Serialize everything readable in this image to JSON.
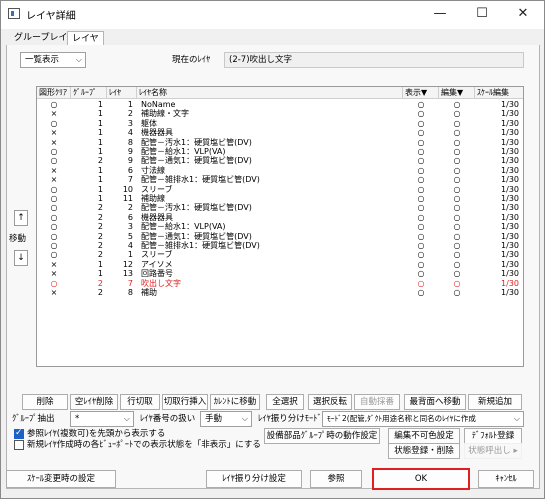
{
  "window": {
    "title": "レイヤ詳細",
    "controls": {
      "minimize": "—",
      "maximize": "☐",
      "close": "✕"
    }
  },
  "tabs": [
    {
      "label": "グループレイヤ"
    },
    {
      "label": "レイヤ"
    }
  ],
  "top": {
    "view_select": "一覧表示",
    "current_layer_label": "現在のﾚｲﾔ",
    "current_layer_value": "(2-7)吹出し文字"
  },
  "table": {
    "headers": {
      "shape": "図形ｸﾘｱ",
      "group": "ｸﾞﾙｰﾌﾟ",
      "layer": "ﾚｲﾔ",
      "name": "ﾚｲﾔ名称",
      "display": "表示▼",
      "edit": "編集▼",
      "scale": "ｽｹｰﾙ編集"
    },
    "rows": [
      {
        "shape": "○",
        "group": "1",
        "layer": "1",
        "name": "NoName",
        "display": "○",
        "edit": "○",
        "scale": "1/30",
        "red": false
      },
      {
        "shape": "×",
        "group": "1",
        "layer": "2",
        "name": "補助線・文字",
        "display": "○",
        "edit": "○",
        "scale": "1/30",
        "red": false
      },
      {
        "shape": "○",
        "group": "1",
        "layer": "3",
        "name": "躯体",
        "display": "○",
        "edit": "○",
        "scale": "1/30",
        "red": false
      },
      {
        "shape": "×",
        "group": "1",
        "layer": "4",
        "name": "機器器具",
        "display": "○",
        "edit": "○",
        "scale": "1/30",
        "red": false
      },
      {
        "shape": "×",
        "group": "1",
        "layer": "8",
        "name": "配管－汚水1：硬質塩ビ管(DV)",
        "display": "○",
        "edit": "○",
        "scale": "1/30",
        "red": false
      },
      {
        "shape": "○",
        "group": "1",
        "layer": "9",
        "name": "配管－給水1：VLP(VA)",
        "display": "○",
        "edit": "○",
        "scale": "1/30",
        "red": false
      },
      {
        "shape": "○",
        "group": "2",
        "layer": "9",
        "name": "配管－通気1：硬質塩ビ管(DV)",
        "display": "○",
        "edit": "○",
        "scale": "1/30",
        "red": false
      },
      {
        "shape": "×",
        "group": "1",
        "layer": "6",
        "name": "寸法線",
        "display": "○",
        "edit": "○",
        "scale": "1/30",
        "red": false
      },
      {
        "shape": "×",
        "group": "1",
        "layer": "7",
        "name": "配管－雑排水1：硬質塩ビ管(DV)",
        "display": "○",
        "edit": "○",
        "scale": "1/30",
        "red": false
      },
      {
        "shape": "○",
        "group": "1",
        "layer": "10",
        "name": "スリーブ",
        "display": "○",
        "edit": "○",
        "scale": "1/30",
        "red": false
      },
      {
        "shape": "○",
        "group": "1",
        "layer": "11",
        "name": "補助線",
        "display": "○",
        "edit": "○",
        "scale": "1/30",
        "red": false
      },
      {
        "shape": "○",
        "group": "2",
        "layer": "2",
        "name": "配管－汚水1：硬質塩ビ管(DV)",
        "display": "○",
        "edit": "○",
        "scale": "1/30",
        "red": false
      },
      {
        "shape": "○",
        "group": "2",
        "layer": "6",
        "name": "機器器具",
        "display": "○",
        "edit": "○",
        "scale": "1/30",
        "red": false
      },
      {
        "shape": "○",
        "group": "2",
        "layer": "3",
        "name": "配管－給水1：VLP(VA)",
        "display": "○",
        "edit": "○",
        "scale": "1/30",
        "red": false
      },
      {
        "shape": "○",
        "group": "2",
        "layer": "5",
        "name": "配管－通気1：硬質塩ビ管(DV)",
        "display": "○",
        "edit": "○",
        "scale": "1/30",
        "red": false
      },
      {
        "shape": "○",
        "group": "2",
        "layer": "4",
        "name": "配管－雑排水1：硬質塩ビ管(DV)",
        "display": "○",
        "edit": "○",
        "scale": "1/30",
        "red": false
      },
      {
        "shape": "○",
        "group": "2",
        "layer": "1",
        "name": "スリーブ",
        "display": "○",
        "edit": "○",
        "scale": "1/30",
        "red": false
      },
      {
        "shape": "×",
        "group": "1",
        "layer": "12",
        "name": "アイソメ",
        "display": "○",
        "edit": "○",
        "scale": "1/30",
        "red": false
      },
      {
        "shape": "×",
        "group": "1",
        "layer": "13",
        "name": "回路番号",
        "display": "○",
        "edit": "○",
        "scale": "1/30",
        "red": false
      },
      {
        "shape": "○",
        "group": "2",
        "layer": "7",
        "name": "吹出し文字",
        "display": "○",
        "edit": "○",
        "scale": "1/30",
        "red": true
      },
      {
        "shape": "×",
        "group": "2",
        "layer": "8",
        "name": "補助",
        "display": "○",
        "edit": "○",
        "scale": "1/30",
        "red": false
      }
    ]
  },
  "side": {
    "up": "↑",
    "move": "移動",
    "down": "↓"
  },
  "buttons_row1": {
    "delete": "削除",
    "delete_empty": "空ﾚｲﾔ削除",
    "cut_row": "行切取",
    "cut_insert": "切取行挿入",
    "current_move": "ｶﾚﾝﾄに移動",
    "select_all": "全選択",
    "invert_select": "選択反転",
    "auto_number": "自動採番",
    "move_to_front": "最背面へ移動",
    "add_new": "新規追加"
  },
  "row2": {
    "group_extract_label": "ｸﾞﾙｰﾌﾟ抽出",
    "group_extract_value": "*",
    "layer_number_label": "ﾚｲﾔ番号の扱い",
    "layer_number_value": "手動",
    "sort_mode_label": "ﾚｲﾔ振り分けﾓｰﾄﾞ",
    "sort_mode_value": "ﾓｰﾄﾞ2(配管,ﾀﾞｸﾄ用途名称と同名のﾚｲﾔに作成"
  },
  "checks": {
    "ref_first": {
      "label": "参照ﾚｲﾔ(複数可)を先頭から表示する",
      "checked": true
    },
    "new_hidden": {
      "label": "新規ﾚｲﾔ作成時の各ﾋﾞｭｰﾎﾟｰﾄでの表示状態を「非表示」にする",
      "checked": false
    }
  },
  "buttons_row3": {
    "equip_group": "設備部品ｸﾞﾙｰﾌﾟ時の動作設定",
    "edit_color": "編集不可色設定",
    "default_register": "ﾃﾞﾌｫﾙﾄ登録",
    "state_register": "状態登録・削除",
    "state_recall": "状態呼出し ▸"
  },
  "footer": {
    "scale_change": "ｽｹｰﾙ変更時の設定",
    "layer_sort": "ﾚｲﾔ振り分け設定",
    "reference": "参照",
    "ok": "OK",
    "cancel": "ｷｬﾝｾﾙ"
  }
}
